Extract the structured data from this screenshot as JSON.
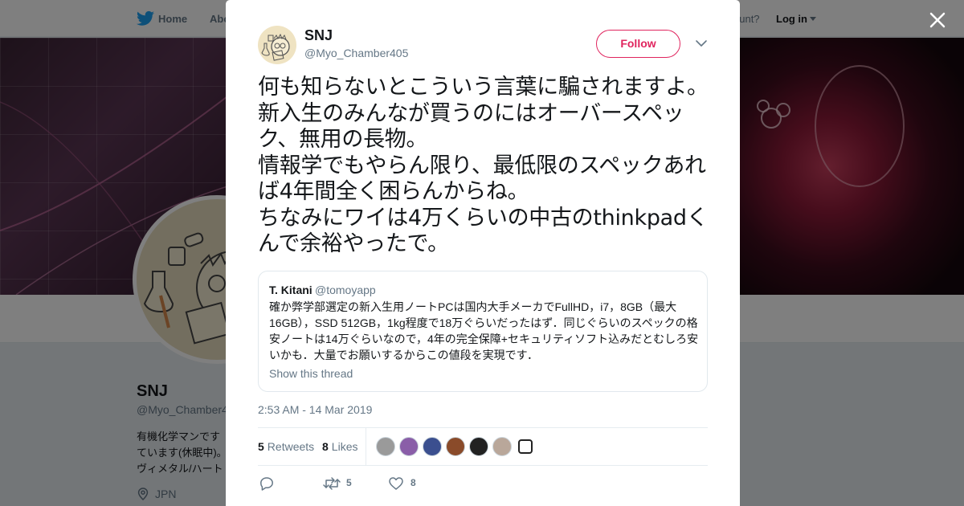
{
  "nav": {
    "home_label": "Home",
    "about_label": "Abo",
    "account_text": "ccount?",
    "login_label": "Log in"
  },
  "profile_bg": {
    "name": "SNJ",
    "handle": "@Myo_Chamber4",
    "bio": "有機化学マンです\nています(休眠中)。\nヴィメタル/ハート",
    "location": "JPN"
  },
  "tweet": {
    "author_name": "SNJ",
    "author_handle": "@Myo_Chamber405",
    "follow_label": "Follow",
    "text": "何も知らないとこういう言葉に騙されますよ。新入生のみんなが買うのにはオーバースペック、無用の長物。\n情報学でもやらん限り、最低限のスペックあれば4年間全く困らんからね。\nちなみにワイは4万くらいの中古のthinkpadくんで余裕やったで。",
    "timestamp": "2:53 AM - 14 Mar 2019",
    "retweet_count": "5",
    "retweets_label": "Retweets",
    "like_count": "8",
    "likes_label": "Likes",
    "action_retweet_count": "5",
    "action_like_count": "8"
  },
  "quote": {
    "name": "T. Kitani",
    "handle": "@tomoyapp",
    "text": "確か弊学部選定の新入生用ノートPCは国内大手メーカでFullHD，i7，8GB（最大16GB），SSD 512GB，1kg程度で18万ぐらいだったはず．同じぐらいのスペックの格安ノートは14万ぐらいなので，4年の完全保障+セキュリティソフト込みだとむしろ安いかも．大量でお願いするからこの値段を実現です．",
    "show_thread": "Show this thread"
  },
  "colors": {
    "accent_pink": "#e0245e",
    "twitter_blue": "#1da1f2",
    "secondary_text": "#657786"
  },
  "likers": [
    {
      "icon": "avatar-gray",
      "color": "#9a9a9a"
    },
    {
      "icon": "avatar-purple",
      "color": "#8a5ea8"
    },
    {
      "icon": "avatar-blue",
      "color": "#3b4f8f"
    },
    {
      "icon": "avatar-orange",
      "color": "#8a4b2a"
    },
    {
      "icon": "avatar-dark",
      "color": "#222222"
    },
    {
      "icon": "avatar-light",
      "color": "#b9a79a"
    },
    {
      "icon": "avatar-logo",
      "color": "#ffffff"
    }
  ]
}
